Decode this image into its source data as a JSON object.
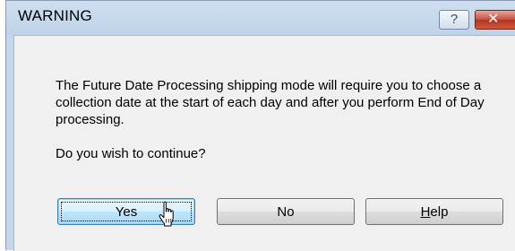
{
  "dialog": {
    "title": "WARNING",
    "help_glyph": "?",
    "close_glyph": "✕",
    "message": "The Future Date Processing shipping mode will require you to choose a collection date at the start of each day and after you perform End of Day processing.",
    "question": "Do you wish to continue?"
  },
  "buttons": {
    "yes_label": "Yes",
    "no_label": "No",
    "help_label": "Help",
    "help_mnemonic": "H"
  },
  "icons": {
    "titlebar_help": "help-icon",
    "titlebar_close": "close-icon",
    "pointer": "hand-pointer-cursor-icon"
  },
  "colors": {
    "titlebar": "#c3d6ea",
    "close_button": "#c75447",
    "default_button": "#bee6fd",
    "content_background": "#f0f0f0"
  }
}
